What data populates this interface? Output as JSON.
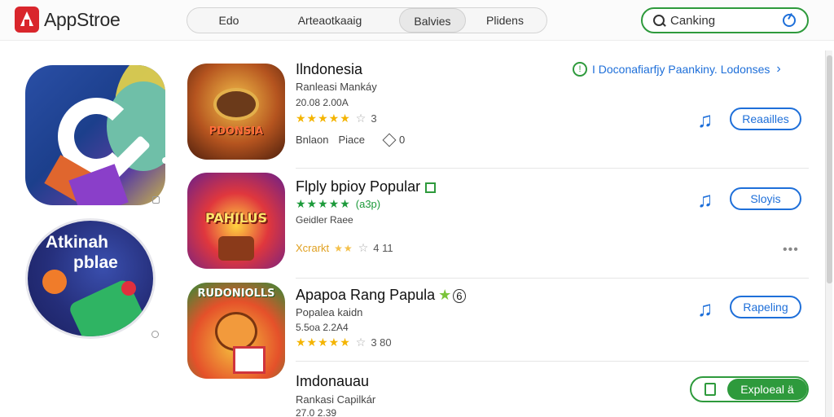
{
  "header": {
    "app_name": "AppStroe",
    "tabs": [
      {
        "label": "Edo"
      },
      {
        "label": "Arteaotkaaig"
      },
      {
        "label": "Balvies"
      },
      {
        "label": "Plidens"
      }
    ],
    "search": {
      "value": "Canking",
      "placeholder": "Canking"
    }
  },
  "featured": [
    {
      "title": "",
      "subtitle": ""
    },
    {
      "title": "Atkinah",
      "subtitle": "pblae"
    }
  ],
  "ranking_link": {
    "label": "I Doconafiarfjy Paankiny. Lodonses"
  },
  "apps": [
    {
      "icon_text": "PDONSIA",
      "name": "Ilndonesia",
      "line1": "Ranleasi Mankáy",
      "line2": "20.08 2.00A",
      "stars": "★★★★★",
      "rating_count": "3",
      "extra_left": "Bnlaon",
      "extra_mid": "Piace",
      "extra_right": "0",
      "button_label": "Reaailles"
    },
    {
      "icon_text": "PAHILUS",
      "name": "Flply bpioy Popular",
      "line1": "(a3p)",
      "line2": "Geidler Raee",
      "stars": "★★★★★",
      "rating_count": "",
      "extra_left": "Xcrarkt",
      "extra_mid": "",
      "extra_right": "4 11",
      "button_label": "Sloyis"
    },
    {
      "icon_text": "RUDONIOLLS",
      "name": "Apapoa Rang Papula",
      "line1": "Popalea kaidn",
      "line2": "5.5oa 2.2A4",
      "stars": "★★★★★",
      "rating_count": "3 80",
      "extra_left": "",
      "extra_mid": "",
      "extra_right": "",
      "button_label": "Rapeling"
    },
    {
      "icon_text": "",
      "name": "Imdonauau",
      "line1": "Rankasi Capilkár",
      "line2": "27.0 2.39",
      "stars": "",
      "rating_count": "",
      "extra_left": "",
      "extra_mid": "",
      "extra_right": "",
      "button_label": "Exploeal ä"
    }
  ],
  "colors": {
    "brand_red": "#d9262c",
    "accent_green": "#2e9a3c",
    "link_blue": "#1e6fd9",
    "star_gold": "#f4b400"
  },
  "icons": [
    "search-icon",
    "mic-icon",
    "music-icon",
    "tag-icon",
    "shopping-bag-icon",
    "chevron-right-icon",
    "more-icon"
  ]
}
